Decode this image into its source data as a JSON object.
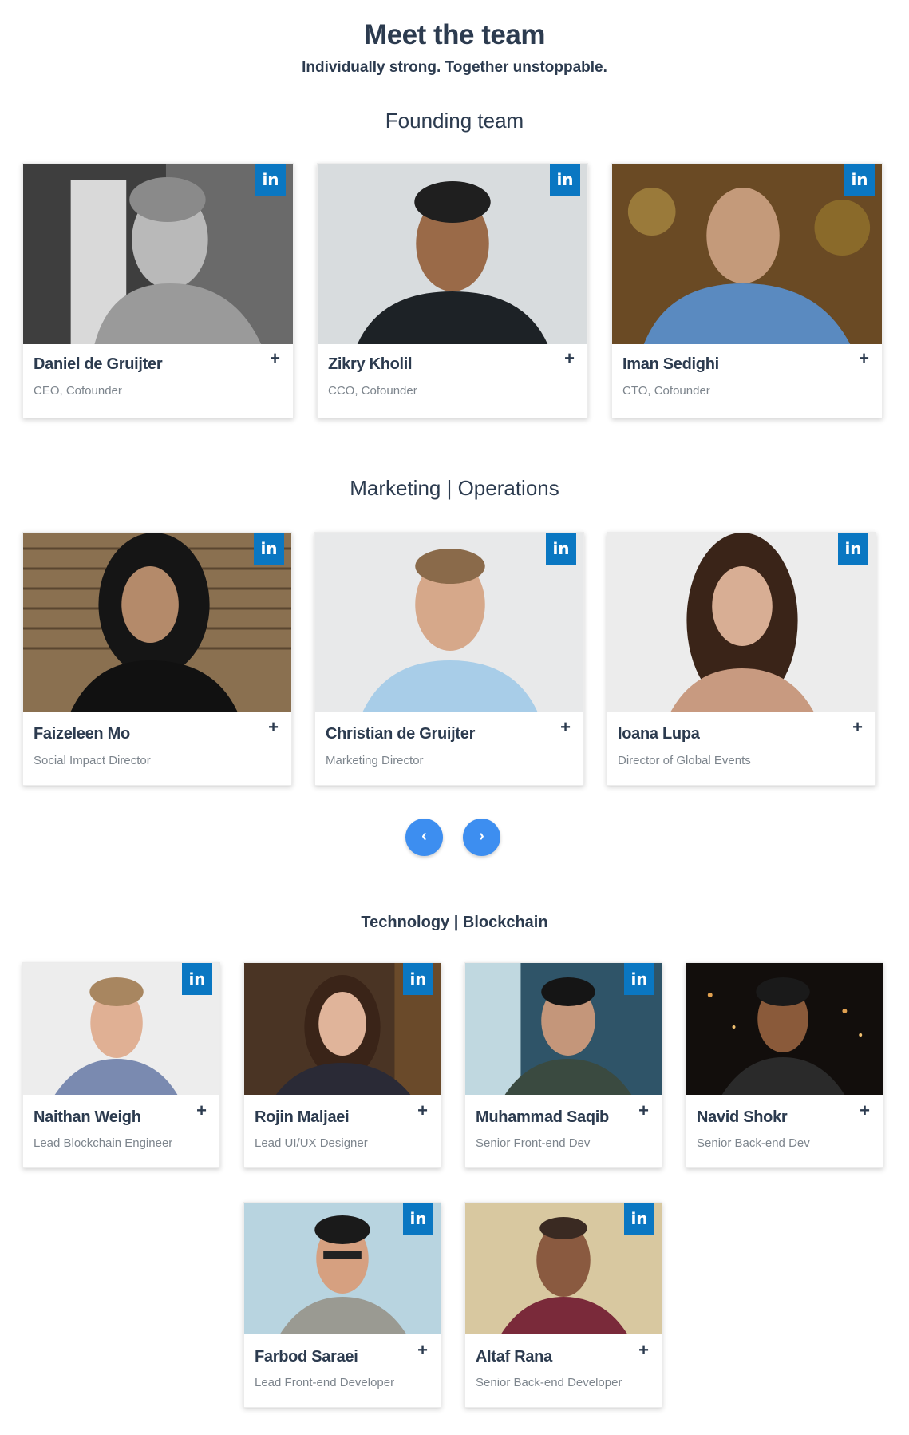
{
  "header": {
    "title": "Meet the team",
    "subtitle": "Individually strong. Together unstoppable."
  },
  "sections": {
    "founding": "Founding team",
    "marketing": "Marketing | Operations",
    "technology": "Technology | Blockchain"
  },
  "linkedin_label": "in",
  "expand_symbol": "+",
  "carousel": {
    "prev": "‹",
    "next": "›"
  },
  "members": [
    {
      "name": "Daniel de Gruijter",
      "role": "CEO, Cofounder"
    },
    {
      "name": "Zikry Kholil",
      "role": "CCO, Cofounder"
    },
    {
      "name": "Iman Sedighi",
      "role": "CTO, Cofounder"
    },
    {
      "name": "Faizeleen Mo",
      "role": "Social Impact Director"
    },
    {
      "name": "Christian de Gruijter",
      "role": "Marketing Director"
    },
    {
      "name": "Ioana Lupa",
      "role": "Director of Global Events"
    },
    {
      "name": "Naithan Weigh",
      "role": "Lead Blockchain Engineer"
    },
    {
      "name": "Rojin Maljaei",
      "role": "Lead UI/UX Designer"
    },
    {
      "name": "Muhammad Saqib",
      "role": "Senior Front-end Dev"
    },
    {
      "name": "Navid Shokr",
      "role": "Senior Back-end Dev"
    },
    {
      "name": "Farbod Saraei",
      "role": "Lead Front-end Developer"
    },
    {
      "name": "Altaf Rana",
      "role": "Senior Back-end Developer"
    }
  ],
  "colors": {
    "text_dark": "#2c3b4f",
    "text_muted": "#7d858d",
    "linkedin_blue": "#0a77c2",
    "nav_blue": "#3d8ef0"
  }
}
